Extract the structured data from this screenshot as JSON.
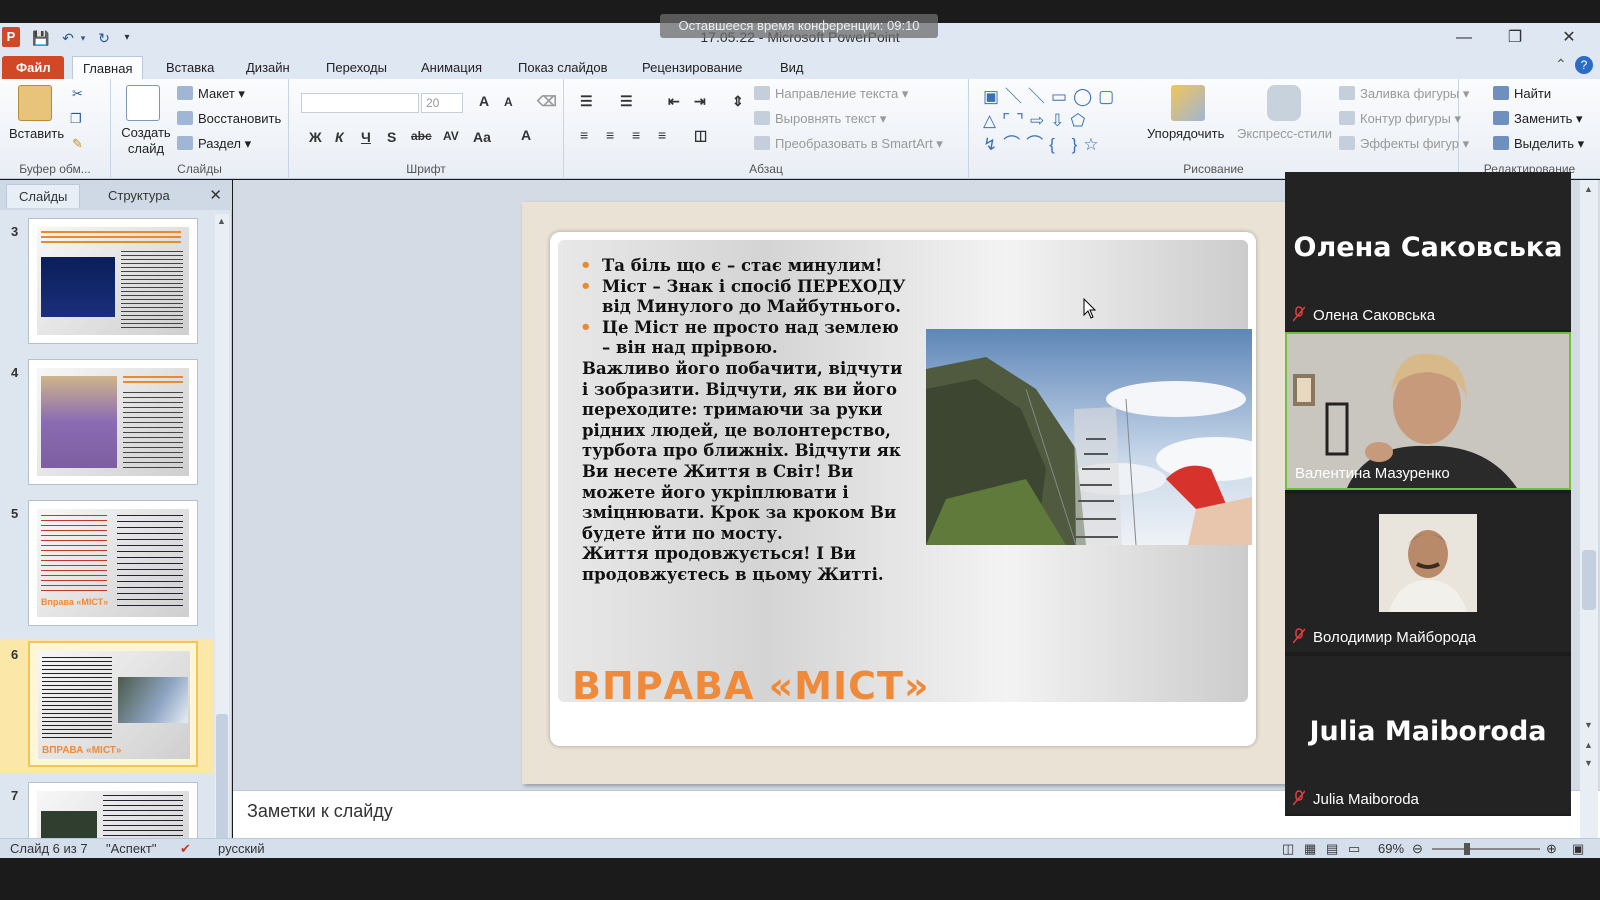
{
  "conference": {
    "timer": "Оставшееся время конференции: 09:10"
  },
  "window": {
    "title": "17.05.22  -  Microsoft PowerPoint"
  },
  "tabs": [
    "Файл",
    "Главная",
    "Вставка",
    "Дизайн",
    "Переходы",
    "Анимация",
    "Показ слайдов",
    "Рецензирование",
    "Вид"
  ],
  "ribbon": {
    "clipboard": {
      "paste": "Вставить",
      "label": "Буфер обм..."
    },
    "slides": {
      "create": "Создать слайд",
      "layout": "Макет",
      "restore": "Восстановить",
      "section": "Раздел",
      "label": "Слайды"
    },
    "font": {
      "size": "20",
      "label": "Шрифт"
    },
    "paragraph": {
      "direction": "Направление текста",
      "align": "Выровнять текст",
      "smartart": "Преобразовать в SmartArt",
      "label": "Абзац"
    },
    "drawing": {
      "arrange": "Упорядочить",
      "quick_styles": "Экспресс-стили",
      "fill": "Заливка фигуры",
      "outline": "Контур фигуры",
      "effects": "Эффекты фигур",
      "label": "Рисование"
    },
    "editing": {
      "find": "Найти",
      "replace": "Заменить",
      "select": "Выделить",
      "label": "Редактирование"
    }
  },
  "panel": {
    "tabs": [
      "Слайды",
      "Структура"
    ],
    "thumbnails": [
      "3",
      "4",
      "5",
      "6",
      "7"
    ],
    "thumb5_caption": "Вправа «МІСТ»",
    "thumb6_caption": "ВПРАВА «МІСТ»"
  },
  "slide": {
    "bullets": [
      "Та біль що є – стає минулим!",
      "Міст – Знак і спосіб ПЕРЕХОДУ  від Минулого до Майбутнього.",
      " Це Міст не просто над землею – він над прірвою."
    ],
    "body": [
      " Важливо його побачити, відчути і зобразити. Відчути, як ви його переходите: тримаючи за руки рідних людей, це волонтерство, турбота про ближніх. Відчути як Ви несете Життя в Світ! Ви можете його укріплювати  і зміцнювати. Крок за кроком Ви будете йти по мосту.",
      "Життя продовжується! І Ви продовжуєтесь в цьому Житті."
    ],
    "title": "ВПРАВА «МІСТ»"
  },
  "notes": {
    "placeholder": "Заметки к слайду"
  },
  "status": {
    "slide": "Слайд 6 из 7",
    "theme": "\"Аспект\"",
    "language": "русский",
    "zoom": "69%"
  },
  "participants": [
    {
      "big_name": "Олена Саковська",
      "name": "Олена Саковська",
      "video": false
    },
    {
      "name": "Валентина Мазуренко",
      "video": true,
      "speaking": true
    },
    {
      "name": "Володимир Майборода",
      "video": "photo"
    },
    {
      "big_name": "Julia Maiboroda",
      "name": "Julia Maiboroda",
      "video": false
    }
  ],
  "colors": {
    "accent": "#d24726",
    "slide_title": "#ef8a3a",
    "speaking": "#6fbf3d"
  }
}
